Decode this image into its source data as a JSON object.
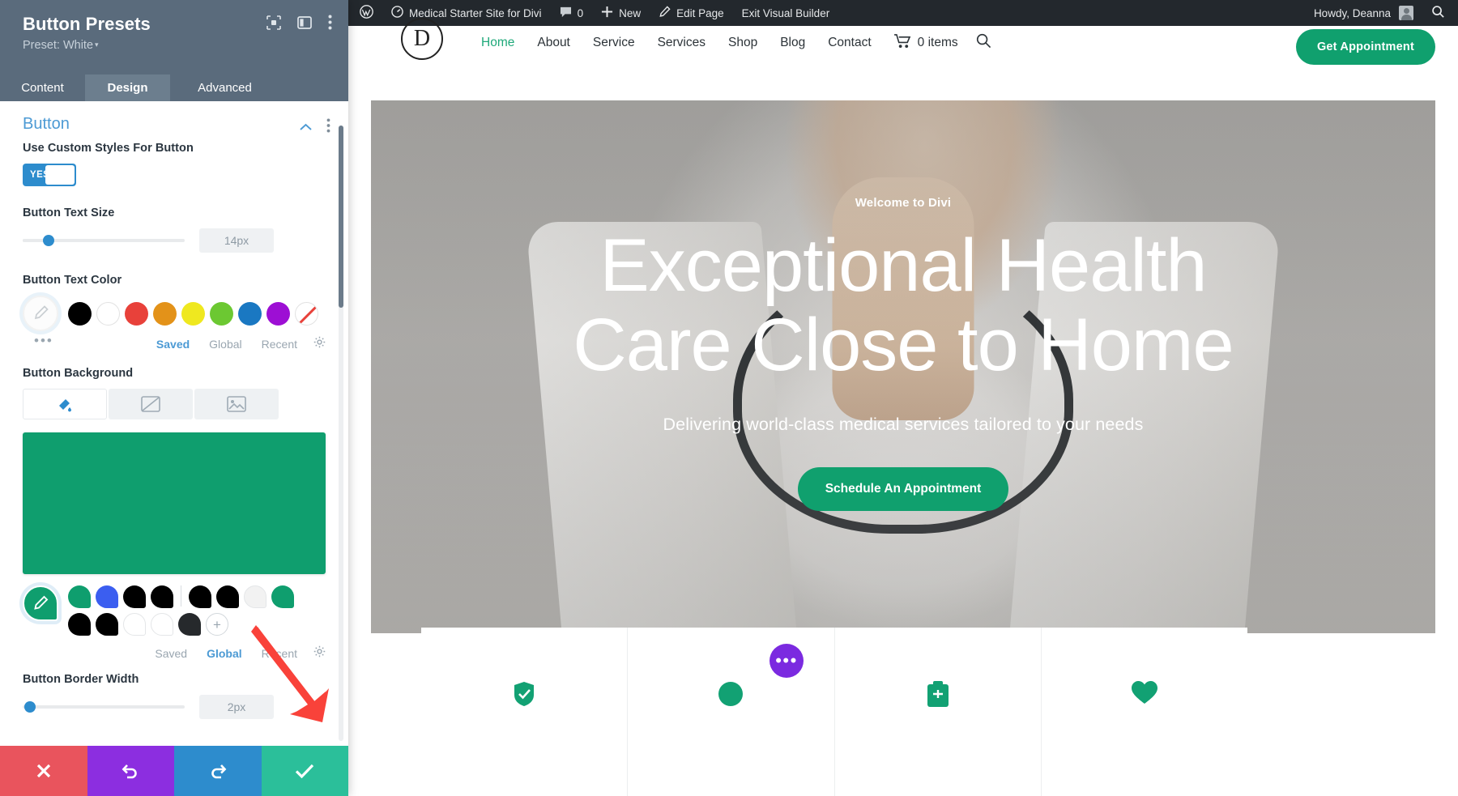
{
  "panel": {
    "title": "Button Presets",
    "preset_label": "Preset: White",
    "preset_caret": "▾",
    "icons": [
      "responsive-icon",
      "layout-columns-icon",
      "more-vertical-icon"
    ],
    "tabs": [
      {
        "label": "Content",
        "active": false
      },
      {
        "label": "Design",
        "active": true
      },
      {
        "label": "Advanced",
        "active": false
      }
    ],
    "section": {
      "title": "Button",
      "icons": [
        "chevron-up-icon",
        "more-vertical-icon"
      ]
    },
    "fields": {
      "use_custom_styles": {
        "label": "Use Custom Styles For Button",
        "toggle_value": "YES"
      },
      "button_text_size": {
        "label": "Button Text Size",
        "value": "14px",
        "slider_percent": 13
      },
      "button_text_color": {
        "label": "Button Text Color",
        "swatches": [
          "#000000",
          "#ffffff",
          "#e8413a",
          "#e39219",
          "#efe81f",
          "#6cc832",
          "#1a78c2",
          "#9d0fd4",
          "none"
        ],
        "more_label": "•••",
        "source_tabs": [
          {
            "label": "Saved",
            "active": true
          },
          {
            "label": "Global",
            "active": false
          },
          {
            "label": "Recent",
            "active": false
          }
        ],
        "gear": "gear-icon"
      },
      "button_background": {
        "label": "Button Background",
        "types": [
          {
            "name": "background-color-tab",
            "icon": "fill-drop-icon",
            "active": true
          },
          {
            "name": "background-gradient-tab",
            "icon": "gradient-icon",
            "active": false
          },
          {
            "name": "background-image-tab",
            "icon": "image-icon",
            "active": false
          }
        ],
        "current_color": "#0f9e6e",
        "saved_row_1": [
          "#0f9e6e",
          "#3b5ef0",
          "#000000",
          "#000000",
          "divider",
          "#000000",
          "#000000",
          "#f2f2f2",
          "#0f9e6e",
          "#000000"
        ],
        "saved_row_2": [
          "#000000",
          "#ffffff",
          "#ffffff",
          "#26292c",
          "plus"
        ],
        "source_tabs": [
          {
            "label": "Saved",
            "active": false
          },
          {
            "label": "Global",
            "active": true
          },
          {
            "label": "Recent",
            "active": false
          }
        ],
        "gear": "gear-icon"
      },
      "button_border_width": {
        "label": "Button Border Width",
        "value": "2px",
        "slider_percent": 3
      }
    },
    "actions": [
      {
        "name": "discard-button",
        "icon": "close-icon",
        "color": "#e9545d"
      },
      {
        "name": "undo-button",
        "icon": "undo-icon",
        "color": "#8c2ee0"
      },
      {
        "name": "redo-button",
        "icon": "redo-icon",
        "color": "#2d8ccd"
      },
      {
        "name": "save-button",
        "icon": "check-icon",
        "color": "#2bbf9a"
      }
    ]
  },
  "wpbar": {
    "items": [
      {
        "label": "",
        "icon": "wordpress-logo-icon"
      },
      {
        "label": "Medical Starter Site for Divi",
        "icon": "dashboard-icon"
      },
      {
        "label": "0",
        "icon": "comment-icon"
      },
      {
        "label": "New",
        "icon": "plus-icon"
      },
      {
        "label": "Edit Page",
        "icon": "pencil-icon"
      },
      {
        "label": "Exit Visual Builder",
        "icon": ""
      }
    ],
    "greeting": "Howdy, Deanna",
    "search_icon": "search-icon",
    "avatar": "avatar"
  },
  "site": {
    "logo_letter": "D",
    "nav": [
      {
        "label": "Home",
        "active": true
      },
      {
        "label": "About",
        "active": false
      },
      {
        "label": "Service",
        "active": false
      },
      {
        "label": "Services",
        "active": false
      },
      {
        "label": "Shop",
        "active": false
      },
      {
        "label": "Blog",
        "active": false
      },
      {
        "label": "Contact",
        "active": false
      }
    ],
    "cart_label": "0 items",
    "cart_icon": "cart-icon",
    "search_icon": "search-icon",
    "cta_label": "Get Appointment",
    "phone_icon": "phone-icon",
    "hero": {
      "kicker": "Welcome to Divi",
      "title_line_1": "Exceptional Health",
      "title_line_2": "Care Close to Home",
      "subtitle": "Delivering world-class medical services tailored to your needs",
      "button_label": "Schedule An Appointment"
    },
    "cards": [
      {
        "icon": "shield-check-icon"
      },
      {
        "icon": "circle-icon"
      },
      {
        "icon": "clipboard-icon"
      },
      {
        "icon": "heart-icon"
      }
    ],
    "row_menu": {
      "label": "•••",
      "color": "#7b2ae0"
    }
  },
  "colors": {
    "accent_blue": "#4c9ad4",
    "brand_green": "#10a06e",
    "panel_header": "#5a6b7c",
    "wp_bar": "#23282d",
    "arrow_red": "#f9423a"
  }
}
